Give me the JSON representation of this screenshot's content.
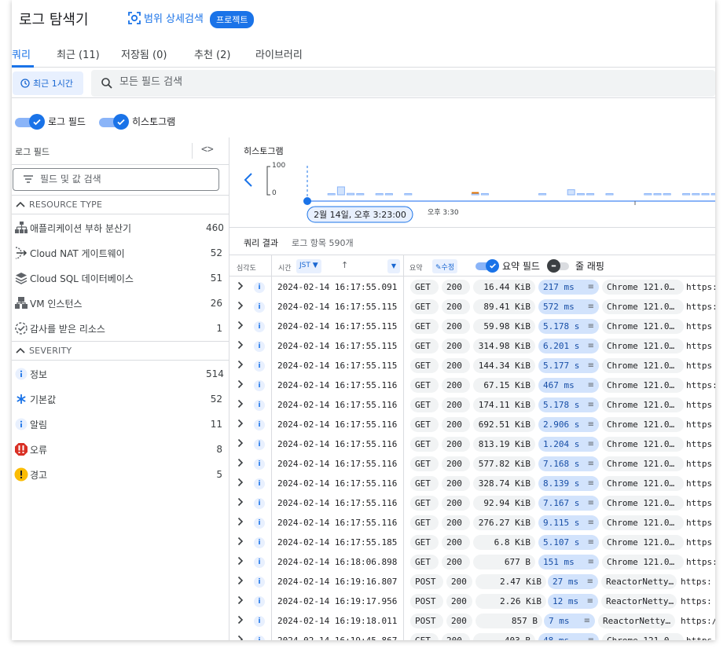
{
  "header": {
    "title": "로그 탐색기",
    "scope_search": "범위 상세검색",
    "preset_badge": "프로젝트"
  },
  "tabs": [
    {
      "label": "쿼리",
      "active": true
    },
    {
      "label": "최근 (11)"
    },
    {
      "label": "저장됨 (0)"
    },
    {
      "label": "추천 (2)"
    },
    {
      "label": "라이브러리"
    }
  ],
  "query": {
    "time_range": "최근 1시간",
    "search_placeholder": "모든 필드 검색"
  },
  "toggles": {
    "log_fields": {
      "label": "로그 필드",
      "on": true
    },
    "histogram": {
      "label": "히스토그램",
      "on": true
    }
  },
  "log_fields_panel": {
    "title": "로그 필드",
    "filter_placeholder": "필드 및 값 검색",
    "sections": [
      {
        "title": "RESOURCE TYPE",
        "items": [
          {
            "label": "애플리케이션 부하 분산기",
            "count": "460",
            "icon": "load-balancer-icon"
          },
          {
            "label": "Cloud NAT 게이트웨이",
            "count": "52",
            "icon": "nat-gateway-icon"
          },
          {
            "label": "Cloud SQL 데이터베이스",
            "count": "51",
            "icon": "sql-database-icon"
          },
          {
            "label": "VM 인스턴스",
            "count": "26",
            "icon": "vm-instance-icon"
          },
          {
            "label": "감사를 받은 리소스",
            "count": "1",
            "icon": "audited-resource-icon"
          }
        ]
      },
      {
        "title": "SEVERITY",
        "items": [
          {
            "label": "정보",
            "count": "514",
            "icon": "info-icon"
          },
          {
            "label": "기본값",
            "count": "52",
            "icon": "default-icon"
          },
          {
            "label": "알림",
            "count": "11",
            "icon": "notice-icon"
          },
          {
            "label": "오류",
            "count": "8",
            "icon": "error-icon"
          },
          {
            "label": "경고",
            "count": "5",
            "icon": "warning-icon"
          }
        ]
      }
    ]
  },
  "histogram": {
    "title": "히스토그램",
    "y_max": "100",
    "y_min": "0",
    "cursor_label": "2월 14일, 오후 3:23:00",
    "tick_label": "오후 3:30",
    "bars": [
      0,
      4,
      28,
      5,
      2,
      0,
      2,
      2,
      0,
      2,
      0,
      0,
      0,
      0,
      0,
      0,
      3,
      2,
      0,
      0,
      0,
      0,
      0,
      4,
      0,
      0,
      18,
      2,
      2,
      0,
      3,
      0,
      0,
      0,
      2,
      2,
      3,
      0,
      2,
      2,
      2,
      2,
      3,
      2
    ],
    "error_bars": [
      0,
      0,
      0,
      0,
      0,
      0,
      0,
      0,
      0,
      0,
      0,
      0,
      0,
      0,
      0,
      0,
      1,
      0,
      0,
      0,
      0,
      0,
      0,
      0,
      0,
      0,
      0,
      0,
      0,
      0,
      0,
      0,
      0,
      0,
      0,
      0,
      0,
      0,
      0,
      0,
      0,
      0,
      1,
      1
    ],
    "colors": {
      "bar": "#d2e3fc",
      "bar_stroke": "#8ab4f8",
      "error": "#e37400",
      "accent": "#1a73e8"
    }
  },
  "results": {
    "title": "쿼리 결과",
    "count": "로그 항목 590개",
    "columns": {
      "severity": "심각도",
      "time": "시간",
      "tz": "JST ▼",
      "sort": "↑",
      "summary": "요약",
      "edit": "✎수정",
      "summary_fields": "요약 필드",
      "line_wrap": "줄 래핑"
    },
    "rows": [
      {
        "ts": "2024-02-14 16:17:55.091",
        "method": "GET",
        "status": "200",
        "size": "16.44 KiB",
        "latency": "217 ms",
        "agent": "Chrome 121.0…",
        "url": "https:"
      },
      {
        "ts": "2024-02-14 16:17:55.115",
        "method": "GET",
        "status": "200",
        "size": "89.41 KiB",
        "latency": "572 ms",
        "agent": "Chrome 121.0…",
        "url": "https:"
      },
      {
        "ts": "2024-02-14 16:17:55.115",
        "method": "GET",
        "status": "200",
        "size": "59.98 KiB",
        "latency": "5.178 s",
        "agent": "Chrome 121.0…",
        "url": "https"
      },
      {
        "ts": "2024-02-14 16:17:55.115",
        "method": "GET",
        "status": "200",
        "size": "314.98 KiB",
        "latency": "6.201 s",
        "agent": "Chrome 121.0…",
        "url": "https"
      },
      {
        "ts": "2024-02-14 16:17:55.115",
        "method": "GET",
        "status": "200",
        "size": "144.34 KiB",
        "latency": "5.177 s",
        "agent": "Chrome 121.0…",
        "url": "https"
      },
      {
        "ts": "2024-02-14 16:17:55.116",
        "method": "GET",
        "status": "200",
        "size": "67.15 KiB",
        "latency": "467 ms",
        "agent": "Chrome 121.0…",
        "url": "https:"
      },
      {
        "ts": "2024-02-14 16:17:55.116",
        "method": "GET",
        "status": "200",
        "size": "174.11 KiB",
        "latency": "5.178 s",
        "agent": "Chrome 121.0…",
        "url": "https"
      },
      {
        "ts": "2024-02-14 16:17:55.116",
        "method": "GET",
        "status": "200",
        "size": "692.51 KiB",
        "latency": "2.906 s",
        "agent": "Chrome 121.0…",
        "url": "https"
      },
      {
        "ts": "2024-02-14 16:17:55.116",
        "method": "GET",
        "status": "200",
        "size": "813.19 KiB",
        "latency": "1.204 s",
        "agent": "Chrome 121.0…",
        "url": "https"
      },
      {
        "ts": "2024-02-14 16:17:55.116",
        "method": "GET",
        "status": "200",
        "size": "577.82 KiB",
        "latency": "7.168 s",
        "agent": "Chrome 121.0…",
        "url": "https"
      },
      {
        "ts": "2024-02-14 16:17:55.116",
        "method": "GET",
        "status": "200",
        "size": "328.74 KiB",
        "latency": "8.139 s",
        "agent": "Chrome 121.0…",
        "url": "https"
      },
      {
        "ts": "2024-02-14 16:17:55.116",
        "method": "GET",
        "status": "200",
        "size": "92.94 KiB",
        "latency": "7.167 s",
        "agent": "Chrome 121.0…",
        "url": "https"
      },
      {
        "ts": "2024-02-14 16:17:55.116",
        "method": "GET",
        "status": "200",
        "size": "276.27 KiB",
        "latency": "9.115 s",
        "agent": "Chrome 121.0…",
        "url": "https"
      },
      {
        "ts": "2024-02-14 16:17:55.185",
        "method": "GET",
        "status": "200",
        "size": "6.8 KiB",
        "latency": "5.107 s",
        "agent": "Chrome 121.0…",
        "url": "https"
      },
      {
        "ts": "2024-02-14 16:18:06.898",
        "method": "GET",
        "status": "200",
        "size": "677 B",
        "latency": "151 ms",
        "agent": "Chrome 121.0…",
        "url": "https:"
      },
      {
        "ts": "2024-02-14 16:19:16.807",
        "method": "POST",
        "status": "200",
        "size": "2.47 KiB",
        "latency": "27 ms",
        "agent": "ReactorNetty…",
        "url": "https:"
      },
      {
        "ts": "2024-02-14 16:19:17.956",
        "method": "POST",
        "status": "200",
        "size": "2.26 KiB",
        "latency": "12 ms",
        "agent": "ReactorNetty…",
        "url": "https:"
      },
      {
        "ts": "2024-02-14 16:19:18.011",
        "method": "POST",
        "status": "200",
        "size": "857 B",
        "latency": "7 ms",
        "agent": "ReactorNetty…",
        "url": "https:/"
      },
      {
        "ts": "2024-02-14 16:19:45.867",
        "method": "GET",
        "status": "200",
        "size": "403 B",
        "latency": "48 ms",
        "agent": "Chrome 121.0…",
        "url": "https"
      }
    ]
  }
}
